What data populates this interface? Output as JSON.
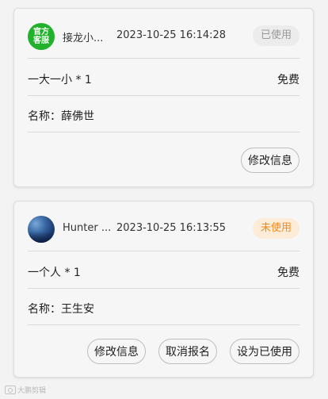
{
  "orders": [
    {
      "avatar": {
        "type": "official",
        "line1": "官方",
        "line2": "客服",
        "color": "#21b12a"
      },
      "nickname": "接龙小...",
      "time": "2023-10-25 16:14:28",
      "status": "已使用",
      "item": "一大一小 * 1",
      "price": "免费",
      "name_label": "名称：",
      "name_value": "薛佛世",
      "actions": [
        "修改信息"
      ]
    },
    {
      "avatar": {
        "type": "photo"
      },
      "nickname": "Hunter ...",
      "time": "2023-10-25 16:13:55",
      "status": "未使用",
      "item": "一个人 * 1",
      "price": "免费",
      "name_label": "名称：",
      "name_value": "王生安",
      "actions": [
        "修改信息",
        "取消报名",
        "设为已使用"
      ]
    }
  ],
  "status_colors": {
    "used": "#9a9a9a",
    "unused": "#f08a1c"
  },
  "watermark": "大鹏剪辑"
}
